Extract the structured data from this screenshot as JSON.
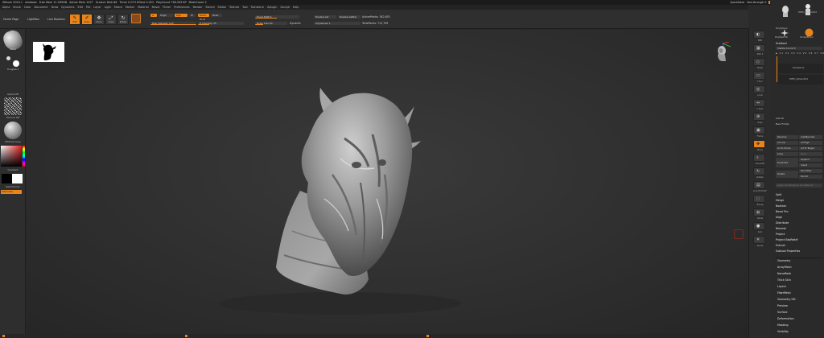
{
  "titlebar": {
    "app": "ZBrush 2023.1",
    "segments": [
      "windows",
      "Free Mem 11.599GB",
      "Active Mem 1027",
      "Scratch Disk 66",
      "Timer 0.073 ATime 0.023",
      "PolyCount 738,353 KP",
      "MeshCount 2"
    ],
    "quicksave": "QuickSave",
    "see_through": "See-through 0",
    "menus": "Menus",
    "default_script": "DefaultZScript"
  },
  "menubar": {
    "items": [
      "Alpha",
      "Brush",
      "Color",
      "Document",
      "Draw",
      "Dynamics",
      "Edit",
      "File",
      "Layer",
      "Light",
      "Macro",
      "Marker",
      "Material",
      "Movie",
      "Picker",
      "Preferences",
      "Render",
      "Stencil",
      "Stroke",
      "Texture",
      "Tool",
      "Transform",
      "Zplugin",
      "Zscript",
      "Help"
    ]
  },
  "toolbar": {
    "tabs": [
      "Home Page",
      "LightBox",
      "Live Boolean"
    ],
    "buttons": [
      {
        "label": "Edit",
        "active": true
      },
      {
        "label": "Draw",
        "active": true
      },
      {
        "label": "Move",
        "active": false
      },
      {
        "label": "Scale",
        "active": false
      },
      {
        "label": "Rotate",
        "active": false
      }
    ],
    "mrgb": "Mrgb",
    "rgb": "Rgb",
    "m": "M",
    "zadd": "Zadd",
    "zsub": "Zsub",
    "zcut": "Zcut",
    "rgb_intensity": "Rgb Intensity 100",
    "z_intensity": "Z Intensity 25",
    "focal_shift": "Focal Shift 0",
    "draw_size": "Draw Size 64",
    "dynamic": "Dynamic",
    "replay_last": "ReplayLast",
    "replay_last_rel": "ReplayLastRel",
    "active_points": "ActivePoints: 382,853",
    "total_points": "TotalPoints: 713,799",
    "adjust": "AdjustLast 1",
    "accent": "#e8841a"
  },
  "left_shelf": {
    "brush_label": "Move",
    "stroke_label": "DragRect",
    "alpha_label": "Alpha Off",
    "texture_label": "Texture Off",
    "material_label": "MatCap Gray",
    "gradient_label": "Gradient",
    "switch_color": "SwitchColor",
    "alternate": "Alternate"
  },
  "right_shelf": {
    "labels": [
      "BPR",
      "SPix 3",
      "Persp",
      "Floor",
      "Local",
      "L.Sym",
      "Gxyz",
      "Frame",
      "Move",
      "Zoom3D",
      "Rotate",
      "Line Fill PolyF",
      "Transp",
      "Ghost",
      "Solo",
      "Xpose"
    ]
  },
  "tray": {
    "tools": [
      "PolySphere",
      "PM3D_Sphere3D1",
      "PolyMesh3D",
      "SimpleBrush"
    ],
    "subtool_heading": "Subtool",
    "visible_count": "Visible Count 5",
    "subtool_items": [
      "PolySphere",
      "PM3D_Sphere3D1"
    ],
    "list_all": "List All",
    "new_folder": "New Folder",
    "btns": [
      [
        "Rename",
        "AutoReorder"
      ],
      [
        "All Low",
        "All High"
      ],
      [
        "All To Home",
        "All To Target"
      ],
      [
        "Copy",
        "Paste"
      ],
      [
        "Duplicate",
        "Append"
      ],
      [
        "",
        "Insert"
      ],
      [
        "",
        "Del Other"
      ],
      [
        "Delete",
        "Del All"
      ]
    ],
    "apply_list": "Apply List Mutes To All Subtools",
    "menu_items": [
      "Split",
      "Merge",
      "Boolean",
      "Bevel Pro",
      "Align",
      "Distribute",
      "Remesh",
      "Project",
      "Project BasRelief",
      "Extract",
      "Subtool Properties"
    ],
    "tool_menus": [
      "Geometry",
      "ArrayMesh",
      "NanoMesh",
      "Thick Skin",
      "Layers",
      "FiberMesh",
      "Geometry HD",
      "Preview",
      "Surface",
      "Deformation",
      "Masking",
      "Visibility"
    ]
  }
}
